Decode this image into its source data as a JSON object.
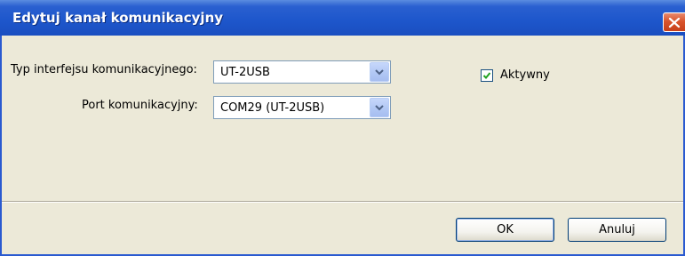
{
  "dialog": {
    "title": "Edytuj kanał komunikacyjny"
  },
  "form": {
    "interface_label": "Typ interfejsu komunikacyjnego:",
    "interface_value": "UT-2USB",
    "port_label": "Port komunikacyjny:",
    "port_value": "COM29 (UT-2USB)",
    "active_label": "Aktywny",
    "active_checked": true
  },
  "buttons": {
    "ok_label": "OK",
    "cancel_label": "Anuluj"
  },
  "icons": {
    "close": "close-icon",
    "dropdown": "chevron-down-icon",
    "check": "checkmark-icon"
  },
  "colors": {
    "titlebar": "#1e57cc",
    "close_button": "#d9542c",
    "dialog_background": "#ece9d8",
    "combo_border": "#7f9db9"
  }
}
